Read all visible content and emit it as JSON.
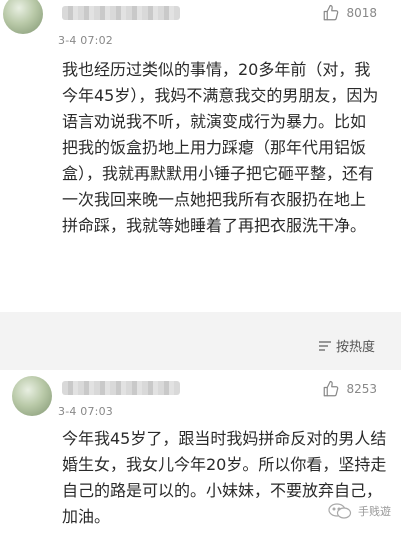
{
  "comments": [
    {
      "timestamp": "3-4 07:02",
      "likes": "8018",
      "text": "我也经历过类似的事情，20多年前（对，我今年45岁），我妈不满意我交的男朋友，因为语言劝说我不听，就演变成行为暴力。比如把我的饭盒扔地上用力踩瘪（那年代用铝饭盒），我就再默默用小锤子把它砸平整，还有一次我回来晚一点她把我所有衣服扔在地上拼命踩，我就等她睡着了再把衣服洗干净。"
    },
    {
      "timestamp": "3-4 07:03",
      "likes": "8253",
      "text": "今年我45岁了，跟当时我妈拼命反对的男人结婚生女，我女儿今年20岁。所以你看，坚持走自己的路是可以的。小妹妹，不要放弃自己，加油。"
    }
  ],
  "sort": {
    "label": "按热度"
  },
  "watermark": {
    "text": "手贱遊"
  },
  "colors": {
    "text": "#2a2a2a",
    "meta": "#888888",
    "band": "#f3f3f3"
  }
}
